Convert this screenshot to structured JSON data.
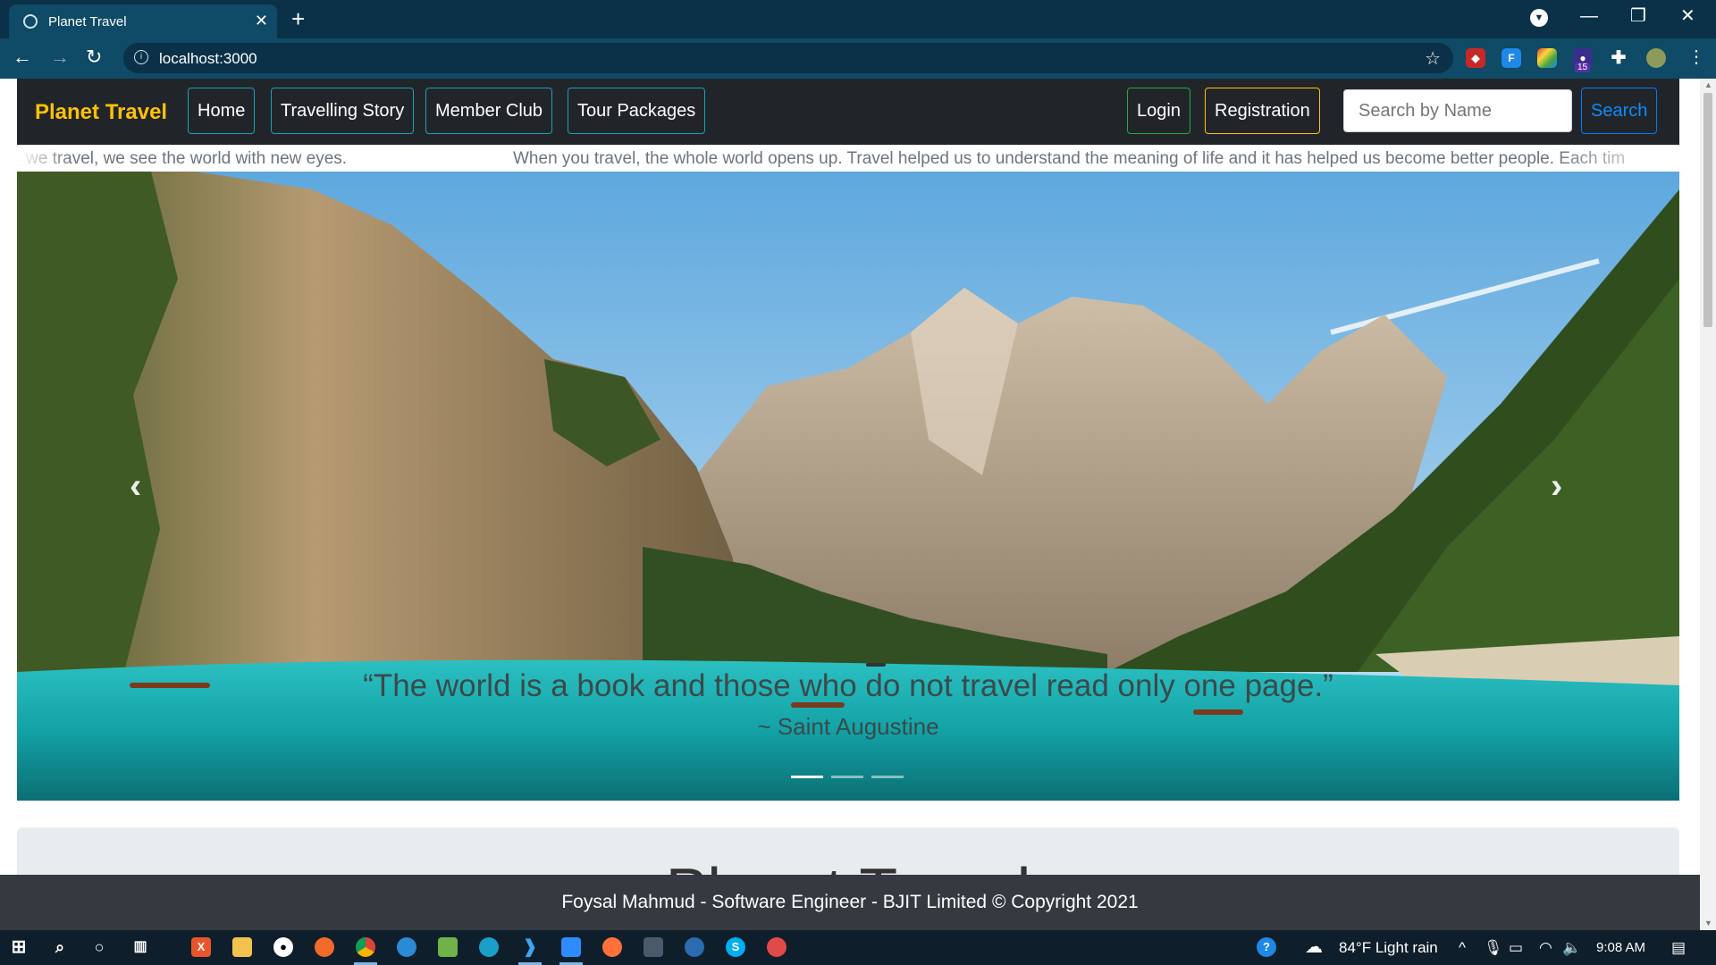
{
  "browser": {
    "tab_title": "Planet Travel",
    "new_tab": "+",
    "url": "localhost:3000",
    "extension_badge": "15",
    "window_controls": {
      "minimize": "—",
      "maximize": "❐",
      "close": "✕"
    }
  },
  "site": {
    "brand": "Planet Travel",
    "nav": {
      "home": "Home",
      "travelling_story": "Travelling Story",
      "member_club": "Member Club",
      "tour_packages": "Tour Packages"
    },
    "auth": {
      "login": "Login",
      "registration": "Registration"
    },
    "search": {
      "placeholder": "Search by Name",
      "button": "Search"
    },
    "marquee": {
      "text_left": "we travel, we see the world with new eyes.",
      "text_right": "When you travel, the whole world opens up. Travel helped us to understand the meaning of life and it has helped us become better people. Each tim"
    },
    "carousel": {
      "quote": "“The world is a book and those who do not travel read only one page.”",
      "author": "~ Saint Augustine",
      "prev": "‹",
      "next": "›",
      "slide_count": 3,
      "active_slide": 1
    },
    "jumbotron_title": "Planet Travel",
    "footer": "Foysal Mahmud - Software Engineer - BJIT Limited © Copyright 2021"
  },
  "taskbar": {
    "weather": "84°F  Light rain",
    "time": "9:08 AM"
  },
  "colors": {
    "chrome_dark": "#0a3147",
    "chrome_toolbar": "#0f4a66",
    "navbar_bg": "#212529",
    "brand": "#ffc107",
    "info_outline": "#17a2b8",
    "success_outline": "#28a745",
    "warning_outline": "#ffc107",
    "primary_outline": "#007bff",
    "footer_bg": "#343a40"
  }
}
